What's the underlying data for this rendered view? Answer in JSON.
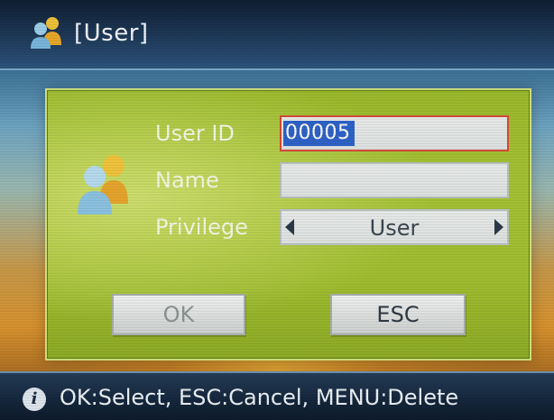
{
  "window": {
    "title": "[User]",
    "icon": "users-icon"
  },
  "form": {
    "user_id_label": "User ID",
    "user_id_value": "00005",
    "name_label": "Name",
    "name_value": "",
    "privilege_label": "Privilege",
    "privilege_value": "User",
    "icon": "users-icon"
  },
  "buttons": {
    "ok_label": "OK",
    "esc_label": "ESC"
  },
  "status": {
    "hint": "OK:Select, ESC:Cancel, MENU:Delete",
    "icon": "info-icon"
  },
  "colors": {
    "dialog": "#a6c335",
    "selection": "#2f63c9",
    "focus_border": "#d84a3a"
  }
}
